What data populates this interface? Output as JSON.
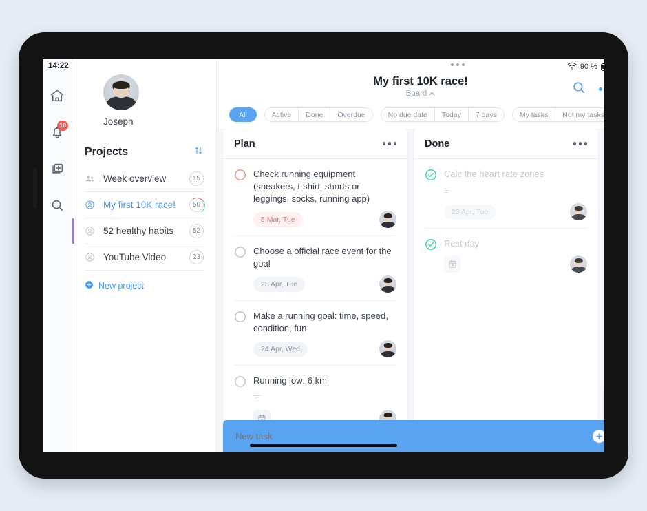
{
  "status_bar": {
    "time": "14:22",
    "battery_pct": "90 %",
    "wifi_icon": "wifi-icon",
    "battery_icon": "battery-icon"
  },
  "rail": {
    "items": [
      {
        "name": "home-icon",
        "icon": "home-icon",
        "badge": null
      },
      {
        "name": "notifications-icon",
        "icon": "bell-icon",
        "badge": "10"
      },
      {
        "name": "add-project-icon",
        "icon": "add-pages-icon",
        "badge": null
      },
      {
        "name": "search-icon",
        "icon": "search-icon",
        "badge": null
      }
    ]
  },
  "sidebar": {
    "user_name": "Joseph",
    "avatar": "user-avatar",
    "projects_heading": "Projects",
    "sort_icon": "sort-arrows-icon",
    "new_project_label": "New project",
    "projects": [
      {
        "label": "Week overview",
        "count": "15",
        "icon": "people-icon",
        "active": false,
        "accent": null
      },
      {
        "label": "My first 10K race!",
        "count": "50",
        "icon": "person-circle-icon",
        "active": true,
        "accent": null
      },
      {
        "label": "52 healthy habits",
        "count": "52",
        "icon": "person-circle-icon",
        "active": false,
        "accent": "#a971e8"
      },
      {
        "label": "YouTube Video",
        "count": "23",
        "icon": "person-circle-icon",
        "active": false,
        "accent": null
      }
    ]
  },
  "header": {
    "title": "My first 10K race!",
    "subtitle": "Board",
    "subtitle_chevron": "chevron-up-icon",
    "search_icon": "search-icon",
    "more_icon": "more-dots-icon"
  },
  "filters": {
    "primary": {
      "label": "All",
      "selected": true
    },
    "group_status": [
      "Active",
      "Done",
      "Overdue"
    ],
    "group_date": [
      "No due date",
      "Today",
      "7 days"
    ],
    "group_owner": [
      "My tasks",
      "Not my tasks"
    ]
  },
  "board": {
    "columns": [
      {
        "title": "Plan",
        "more_icon": "more-dots-icon",
        "tasks": [
          {
            "text": "Check running equipment (sneakers, t-shirt, shorts or leggings, socks, running app)",
            "state": "overdue",
            "checkbox_icon": "circle-empty-icon",
            "date": "5 Mar, Tue",
            "has_description": false,
            "has_calendar_button": false,
            "assignee_avatar": "user-avatar"
          },
          {
            "text": "Choose a official race event for the goal",
            "state": "open",
            "checkbox_icon": "circle-empty-icon",
            "date": "23 Apr, Tue",
            "has_description": false,
            "has_calendar_button": false,
            "assignee_avatar": "user-avatar"
          },
          {
            "text": "Make a running goal: time, speed, condition, fun",
            "state": "open",
            "checkbox_icon": "circle-empty-icon",
            "date": "24 Apr, Wed",
            "has_description": false,
            "has_calendar_button": false,
            "assignee_avatar": "user-avatar"
          },
          {
            "text": "Running low: 6 km",
            "state": "open",
            "checkbox_icon": "circle-empty-icon",
            "date": null,
            "has_description": true,
            "has_calendar_button": true,
            "assignee_avatar": "user-avatar"
          }
        ]
      },
      {
        "title": "Done",
        "more_icon": "more-dots-icon",
        "tasks": [
          {
            "text": "Calc the heart rate zones",
            "state": "done",
            "checkbox_icon": "circle-check-icon",
            "date": "23 Apr, Tue",
            "has_description": true,
            "has_calendar_button": false,
            "assignee_avatar": "user-avatar"
          },
          {
            "text": "Rest day",
            "state": "done",
            "checkbox_icon": "circle-check-icon",
            "date": null,
            "has_description": false,
            "has_calendar_button": true,
            "assignee_avatar": "user-avatar"
          }
        ]
      }
    ]
  },
  "zoom_controls": {
    "zoom_in_icon": "zoom-in-icon",
    "zoom_out_icon": "zoom-out-icon"
  },
  "new_task": {
    "placeholder": "New task",
    "add_icon": "plus-icon"
  },
  "colors": {
    "accent_blue": "#5aa3f0",
    "overdue_red": "#f2746a",
    "done_green": "#2fd0a5",
    "purple_accent": "#a971e8",
    "badge_red": "#fa5a52",
    "page_bg": "#e7ecf4"
  }
}
